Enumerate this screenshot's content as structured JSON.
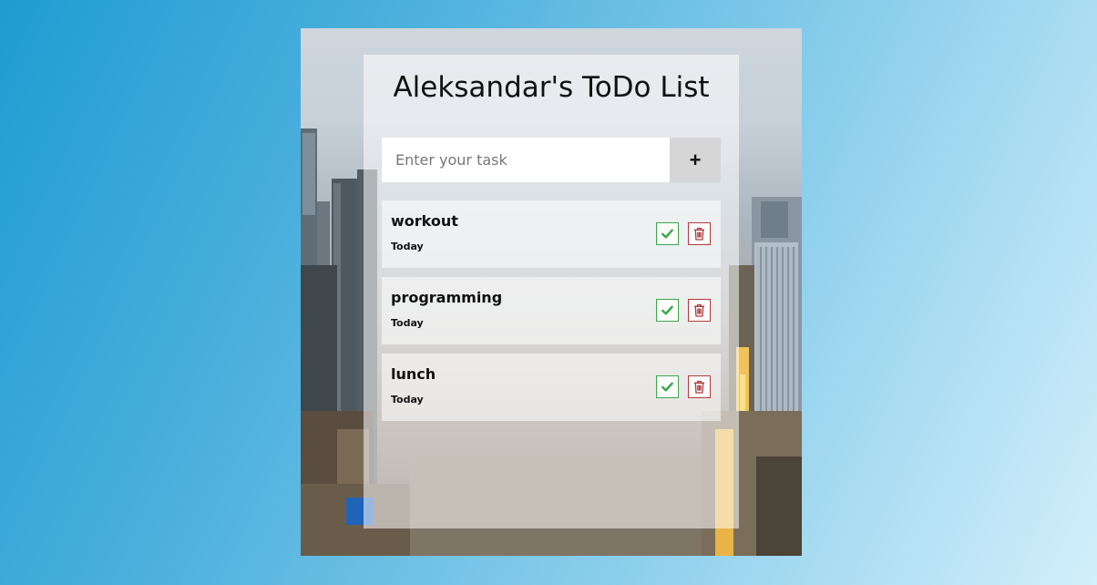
{
  "app": {
    "title": "Aleksandar's ToDo List"
  },
  "add_form": {
    "placeholder": "Enter your task",
    "add_label": "+"
  },
  "tasks": [
    {
      "name": "workout",
      "date": "Today"
    },
    {
      "name": "programming",
      "date": "Today"
    },
    {
      "name": "lunch",
      "date": "Today"
    }
  ],
  "icons": {
    "complete": "check-icon",
    "delete": "trash-icon"
  },
  "colors": {
    "complete": "#3aa84a",
    "delete": "#b03a3a",
    "add_button_bg": "#d6d6d6"
  }
}
